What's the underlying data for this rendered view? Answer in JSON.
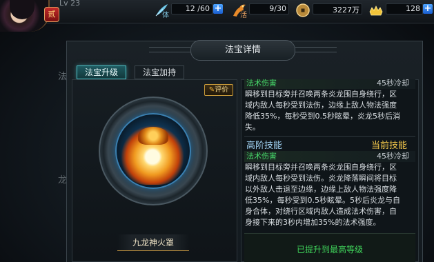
{
  "top_bar": {
    "level_text": "Lv 23",
    "vip_label": "贰",
    "resources": [
      {
        "name": "stamina",
        "icon": "feather-icon",
        "icon_label": "体",
        "value": "12 /60",
        "has_plus": true
      },
      {
        "name": "energy",
        "icon": "flame-horse-icon",
        "icon_label": "活",
        "value": "9/30",
        "has_plus": false
      },
      {
        "name": "coins",
        "icon": "coin-icon",
        "value": "3227万",
        "has_plus": false
      },
      {
        "name": "ingots",
        "icon": "gold-ingot-icon",
        "value": "128",
        "has_plus": true
      }
    ]
  },
  "background": {
    "side_text": "法",
    "side_text2": "龙"
  },
  "dialog": {
    "title": "法宝详情",
    "tabs": [
      {
        "label": "法宝升级",
        "active": true
      },
      {
        "label": "法宝加持",
        "active": false
      }
    ],
    "rate_button": "评价",
    "artifact_name": "九龙神火罩",
    "current_skill": {
      "type_label": "法术伤害",
      "cooldown": "45秒冷却",
      "description_lines": [
        "瞬移到目标旁并召唤两条炎龙围自身绕行，区",
        "域内敌人每秒受到法伤，边缘上敌人物法强度",
        "降低35%，每秒受到0.5秒眩晕，炎龙5秒后消",
        "失。"
      ]
    },
    "advanced_skill": {
      "heading": "高阶技能",
      "current_tag": "当前技能",
      "type_label": "法术伤害",
      "cooldown": "45秒冷却",
      "description_lines": [
        "瞬移到目标旁并召唤两条炎龙围自身绕行，区",
        "域内敌人每秒受到法伤。炎龙降落瞬间将目标",
        "以外敌人击退至边缘，边缘上敌人物法强度降",
        "低35%，每秒受到0.5秒眩晕。5秒后炎龙与自",
        "身合体，对绕行区域内敌人造成法术伤害，自",
        "身接下来的3秒内增加35%的法术强度。"
      ]
    },
    "max_level_text": "已提升到最高等级"
  },
  "colors": {
    "accent_teal": "#4ec3c9",
    "skill_green": "#47d86a",
    "gold": "#f0c54a",
    "plus_blue": "#1a5fd0"
  }
}
